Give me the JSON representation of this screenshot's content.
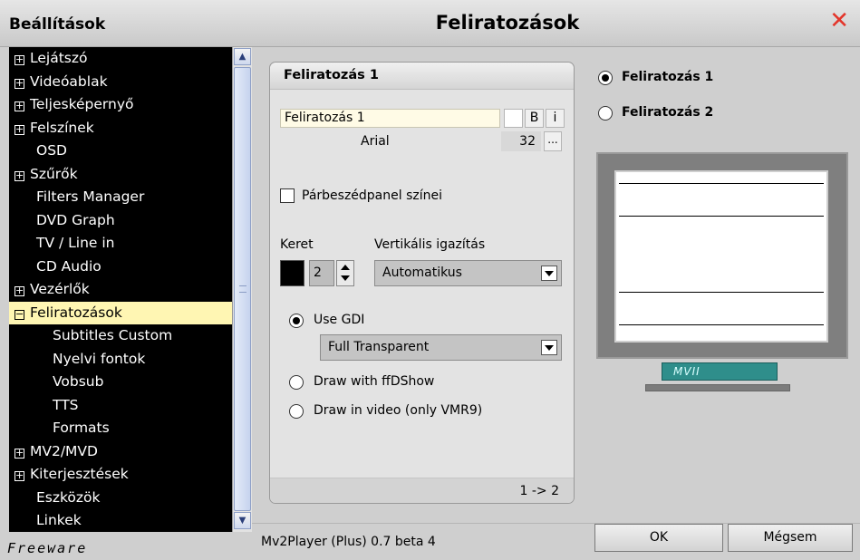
{
  "titlebar": {
    "left_title": "Beállítások",
    "center_title": "Feliratozások",
    "close_glyph": "✕"
  },
  "sidebar": {
    "items": [
      {
        "prefix": "+",
        "label": "Lejátszó"
      },
      {
        "prefix": "+",
        "label": "Videóablak"
      },
      {
        "prefix": "+",
        "label": "Teljesképernyő"
      },
      {
        "prefix": "+",
        "label": "Felszínek"
      },
      {
        "prefix": "",
        "label": "OSD"
      },
      {
        "prefix": "+",
        "label": "Szűrők"
      },
      {
        "prefix": "",
        "label": "Filters Manager"
      },
      {
        "prefix": "",
        "label": "DVD Graph"
      },
      {
        "prefix": "",
        "label": "TV / Line in"
      },
      {
        "prefix": "",
        "label": "CD Audio"
      },
      {
        "prefix": "+",
        "label": "Vezérlők"
      },
      {
        "prefix": "−",
        "label": "Feliratozások",
        "selected": true
      },
      {
        "prefix": "",
        "label": "Subtitles Custom",
        "child": true
      },
      {
        "prefix": "",
        "label": "Nyelvi fontok",
        "child": true
      },
      {
        "prefix": "",
        "label": "Vobsub",
        "child": true
      },
      {
        "prefix": "",
        "label": "TTS",
        "child": true
      },
      {
        "prefix": "",
        "label": "Formats",
        "child": true
      },
      {
        "prefix": "+",
        "label": "MV2/MVD"
      },
      {
        "prefix": "+",
        "label": "Kiterjesztések"
      },
      {
        "prefix": "",
        "label": "Eszközök"
      },
      {
        "prefix": "",
        "label": "Linkek"
      }
    ],
    "footer": "Freeware"
  },
  "panel": {
    "title": "Feliratozás 1",
    "font_name": "Feliratozás 1",
    "bold_label": "B",
    "italic_label": "i",
    "font_face": "Arial",
    "font_size": "32",
    "dots_label": "...",
    "dialog_colors_label": "Párbeszédpanel színei",
    "keret_label": "Keret",
    "keret_value": "2",
    "valign_label": "Vertikális igazítás",
    "valign_value": "Automatikus",
    "use_gdi_label": "Use GDI",
    "transparency_value": "Full Transparent",
    "ffdshow_label": "Draw with ffDShow",
    "vmr9_label": "Draw in video (only VMR9)",
    "page_indicator": "1 -> 2"
  },
  "right": {
    "radio1_label": "Feliratozás 1",
    "radio2_label": "Feliratozás 2",
    "monitor_badge": "MVII"
  },
  "status": {
    "version": "Mv2Player (Plus) 0.7 beta 4"
  },
  "buttons": {
    "ok": "OK",
    "cancel": "Mégsem"
  },
  "colors": {
    "close": "#e3352a",
    "selected_bg": "#fff6b3",
    "badge": "#2f8e8b"
  }
}
